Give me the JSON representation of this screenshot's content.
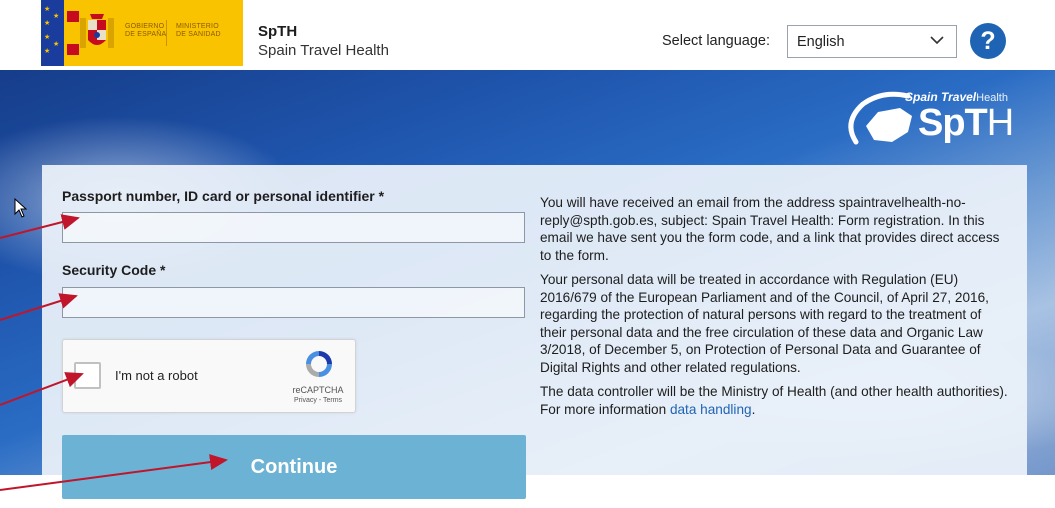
{
  "header": {
    "gov_line1": "Gobierno",
    "gov_line2": "de España",
    "ministry_line1": "Ministerio",
    "ministry_line2": "de Sanidad",
    "app_name": "SpTH",
    "app_subtitle": "Spain Travel Health",
    "language_label": "Select language:",
    "language_value": "English",
    "help_label": "?"
  },
  "brand": {
    "line1_bold": "Spain Travel",
    "line1_light": "Health",
    "line2_bold": "SpT",
    "line2_light": "H"
  },
  "form": {
    "id_label": "Passport number, ID card or personal identifier *",
    "id_value": "",
    "security_label": "Security Code *",
    "security_value": "",
    "captcha_text": "I'm not a robot",
    "captcha_brand": "reCAPTCHA",
    "captcha_terms": "Privacy - Terms",
    "continue_label": "Continue"
  },
  "info": {
    "p1": "You will have received an email from the address spaintravelhealth-no-reply@spth.gob.es, subject: Spain Travel Health: Form registration. In this email we have sent you the form code, and a link that provides direct access to the form.",
    "p2": "Your personal data will be treated in accordance with Regulation (EU) 2016/679 of the European Parliament and of the Council, of April 27, 2016, regarding the protection of natural persons with regard to the treatment of their personal data and the free circulation of these data and Organic Law 3/2018, of December 5, on Protection of Personal Data and Guarantee of Digital Rights and other related regulations.",
    "p3_text": "The data controller will be the Ministry of Health (and other health authorities). For more information ",
    "p3_link": "data handling",
    "p3_end": "."
  },
  "colors": {
    "accent": "#1f64b4",
    "gov_yellow": "#f9c300",
    "continue_button": "#6cb2d4",
    "annotation_arrow": "#c0152a"
  },
  "icons": [
    "chevron-down-icon",
    "help-icon",
    "recaptcha-icon",
    "cursor-icon",
    "spain-map-logo-icon"
  ]
}
